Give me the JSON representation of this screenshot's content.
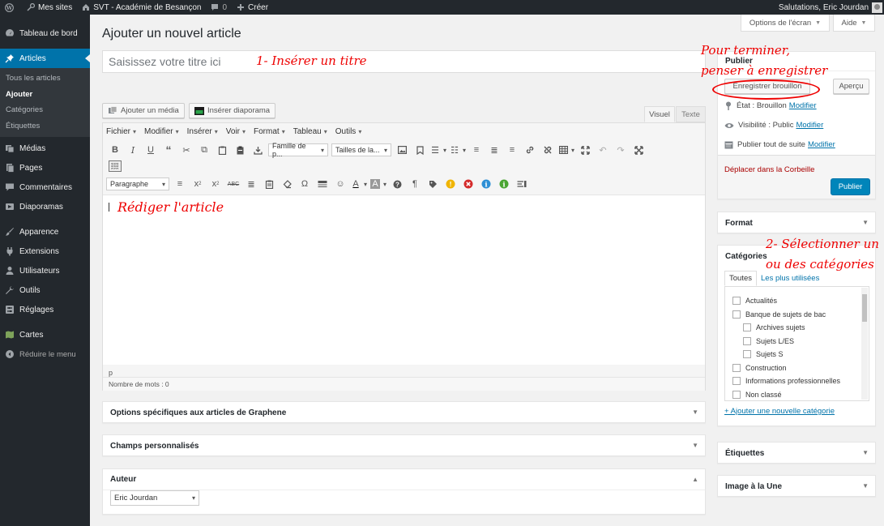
{
  "adminbar": {
    "my_sites": "Mes sites",
    "site_name": "SVT - Académie de Besançon",
    "comments_count": "0",
    "create": "Créer",
    "greeting": "Salutations, Eric Jourdan"
  },
  "sidebar": {
    "items": [
      {
        "label": "Tableau de bord",
        "icon": "dashboard-icon"
      },
      {
        "label": "Articles",
        "icon": "pin-icon"
      },
      {
        "label": "Médias",
        "icon": "media-icon"
      },
      {
        "label": "Pages",
        "icon": "pages-icon"
      },
      {
        "label": "Commentaires",
        "icon": "comment-icon"
      },
      {
        "label": "Diaporamas",
        "icon": "slideshow-icon"
      },
      {
        "label": "Apparence",
        "icon": "brush-icon"
      },
      {
        "label": "Extensions",
        "icon": "plugin-icon"
      },
      {
        "label": "Utilisateurs",
        "icon": "users-icon"
      },
      {
        "label": "Outils",
        "icon": "wrench-icon"
      },
      {
        "label": "Réglages",
        "icon": "settings-icon"
      },
      {
        "label": "Cartes",
        "icon": "map-icon"
      }
    ],
    "submenu": [
      "Tous les articles",
      "Ajouter",
      "Catégories",
      "Étiquettes"
    ],
    "collapse": "Réduire le menu"
  },
  "screen_options": "Options de l'écran",
  "help": "Aide",
  "page_title": "Ajouter un nouvel article",
  "title_placeholder": "Saisissez votre titre ici",
  "media_buttons": {
    "add_media": "Ajouter un média",
    "insert_slideshow": "Insérer diaporama"
  },
  "editor_tabs": {
    "visual": "Visuel",
    "text": "Texte"
  },
  "editor_menu": [
    "Fichier",
    "Modifier",
    "Insérer",
    "Voir",
    "Format",
    "Tableau",
    "Outils"
  ],
  "toolbar": {
    "font_family": "Famille de p...",
    "font_size": "Tailles de la...",
    "paragraph": "Paragraphe"
  },
  "editor_status_path": "p",
  "word_count": "Nombre de mots : 0",
  "metaboxes": {
    "graphene": "Options spécifiques aux articles de Graphene",
    "custom_fields": "Champs personnalisés",
    "author": "Auteur",
    "author_value": "Eric Jourdan"
  },
  "publish": {
    "title": "Publier",
    "save_draft": "Enregistrer brouillon",
    "preview": "Aperçu",
    "status_label": "État : Brouillon",
    "visibility_label": "Visibilité : Public",
    "schedule_label": "Publier tout de suite",
    "modify": "Modifier",
    "trash": "Déplacer dans la Corbeille",
    "publish_btn": "Publier"
  },
  "format_box": "Format",
  "categories": {
    "title": "Catégories",
    "tab_all": "Toutes",
    "tab_popular": "Les plus utilisées",
    "items": [
      {
        "label": "Actualités",
        "level": 0
      },
      {
        "label": "Banque de sujets de bac",
        "level": 0
      },
      {
        "label": "Archives sujets",
        "level": 1
      },
      {
        "label": "Sujets L/ES",
        "level": 1
      },
      {
        "label": "Sujets S",
        "level": 1
      },
      {
        "label": "Construction",
        "level": 0
      },
      {
        "label": "Informations professionnelles",
        "level": 0
      },
      {
        "label": "Non classé",
        "level": 0
      }
    ],
    "add_new": "+ Ajouter une nouvelle catégorie"
  },
  "tags_box": "Étiquettes",
  "featured_image_box": "Image à la Une",
  "annotations": {
    "title_hint": "1- Insérer un titre",
    "write_hint": "Rédiger l'article",
    "save_hint_line1": "Pour terminer,",
    "save_hint_line2": "penser à enregistrer",
    "cat_hint_line1": "2- Sélectionner un",
    "cat_hint_line2": "ou des catégories"
  },
  "colors": {
    "admin_dark": "#23282d",
    "accent": "#0073aa",
    "annotation": "#ee0000"
  }
}
